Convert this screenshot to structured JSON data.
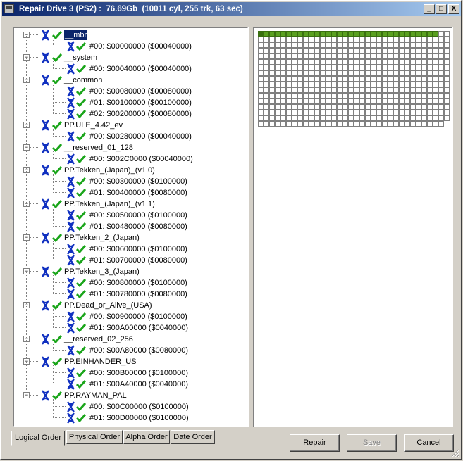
{
  "window": {
    "title": "Repair Drive 3 (PS2) :  76.69Gb  (10011 cyl, 255 trk, 63 sec)",
    "controls": {
      "minimize": "_",
      "maximize": "□",
      "close": "X"
    }
  },
  "colors": {
    "check": "#1aa51a",
    "xicon": "#1030c0",
    "block_used": "#5aa020",
    "block_used_dark": "#3a7010",
    "selection": "#0a246a"
  },
  "tree": [
    {
      "name": "__mbr",
      "selected": true,
      "parts": [
        "#00: $00000000 ($00040000)"
      ]
    },
    {
      "name": "__system",
      "parts": [
        "#00: $00040000 ($00040000)"
      ]
    },
    {
      "name": "__common",
      "parts": [
        "#00: $00080000 ($00080000)",
        "#01: $00100000 ($00100000)",
        "#02: $00200000 ($00080000)"
      ]
    },
    {
      "name": "PP.ULE_4.42_ev",
      "parts": [
        "#00: $00280000 ($00040000)"
      ]
    },
    {
      "name": "__reserved_01_128",
      "parts": [
        "#00: $002C0000 ($00040000)"
      ]
    },
    {
      "name": "PP.Tekken_(Japan)_(v1.0)",
      "parts": [
        "#00: $00300000 ($0100000)",
        "#01: $00400000 ($0080000)"
      ]
    },
    {
      "name": "PP.Tekken_(Japan)_(v1.1)",
      "parts": [
        "#00: $00500000 ($0100000)",
        "#01: $00480000 ($0080000)"
      ]
    },
    {
      "name": "PP.Tekken_2_(Japan)",
      "parts": [
        "#00: $00600000 ($0100000)",
        "#01: $00700000 ($0080000)"
      ]
    },
    {
      "name": "PP.Tekken_3_(Japan)",
      "parts": [
        "#00: $00800000 ($0100000)",
        "#01: $00780000 ($0080000)"
      ]
    },
    {
      "name": "PP.Dead_or_Alive_(USA)",
      "parts": [
        "#00: $00900000 ($0100000)",
        "#01: $00A00000 ($0040000)"
      ]
    },
    {
      "name": "__reserved_02_256",
      "parts": [
        "#00: $00A80000 ($0080000)"
      ]
    },
    {
      "name": "PP.EINHANDER_US",
      "parts": [
        "#00: $00B00000 ($0100000)",
        "#01: $00A40000 ($0040000)"
      ]
    },
    {
      "name": "PP.RAYMAN_PAL",
      "parts": [
        "#00: $00C00000 ($0100000)",
        "#01: $00D00000 ($0100000)"
      ]
    }
  ],
  "block_map": {
    "total_blocks": 577,
    "used_blocks": 32,
    "first_block_highlight": true
  },
  "tabs": [
    {
      "label": "Logical Order",
      "active": true
    },
    {
      "label": "Physical Order"
    },
    {
      "label": "Alpha Order"
    },
    {
      "label": "Date Order"
    }
  ],
  "buttons": {
    "repair": {
      "label": "Repair",
      "enabled": true
    },
    "save": {
      "label": "Save",
      "enabled": false
    },
    "cancel": {
      "label": "Cancel",
      "enabled": true
    }
  }
}
